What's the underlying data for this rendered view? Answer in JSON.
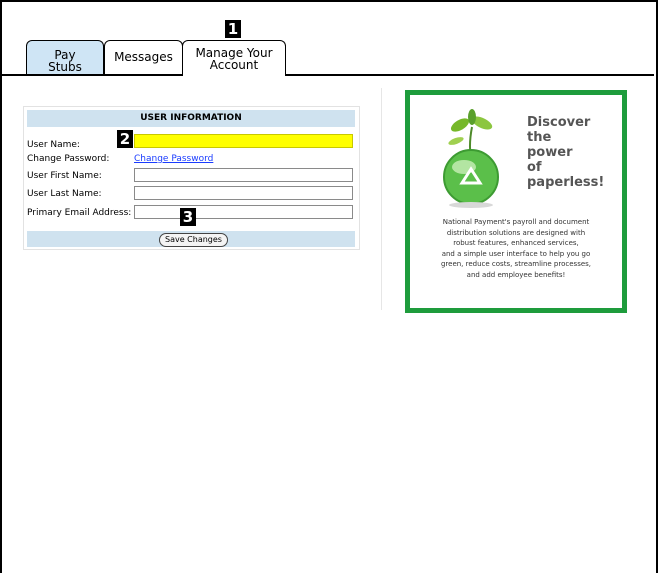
{
  "tabs": [
    {
      "label_line1": "Pay",
      "label_line2": "Stubs"
    },
    {
      "label": "Messages"
    },
    {
      "label_line1": "Manage Your",
      "label_line2": "Account"
    }
  ],
  "callouts": [
    "1",
    "2",
    "3"
  ],
  "form": {
    "heading": "USER INFORMATION",
    "fields": {
      "user_name_label": "User Name:",
      "change_password_label": "Change Password:",
      "change_password_link": "Change Password",
      "first_name_label": "User First Name:",
      "last_name_label": "User Last Name:",
      "email_label": "Primary Email Address:"
    },
    "save_button": "Save Changes"
  },
  "ad": {
    "title_lines": [
      "Discover",
      "the",
      "power",
      "of",
      "paperless!"
    ],
    "body_lines": [
      "National Payment's payroll and document",
      "distribution solutions are designed with",
      "robust features, enhanced services,",
      "and a simple user interface to help you go",
      "green, reduce costs, streamline processes,",
      "and add employee benefits!"
    ],
    "accent_color": "#1e9c3c"
  },
  "colors": {
    "tab_active_bg": "#cfe5f5",
    "panel_bar_bg": "#cfe2ef",
    "username_highlight": "#ffff00",
    "link": "#1a3cff"
  }
}
